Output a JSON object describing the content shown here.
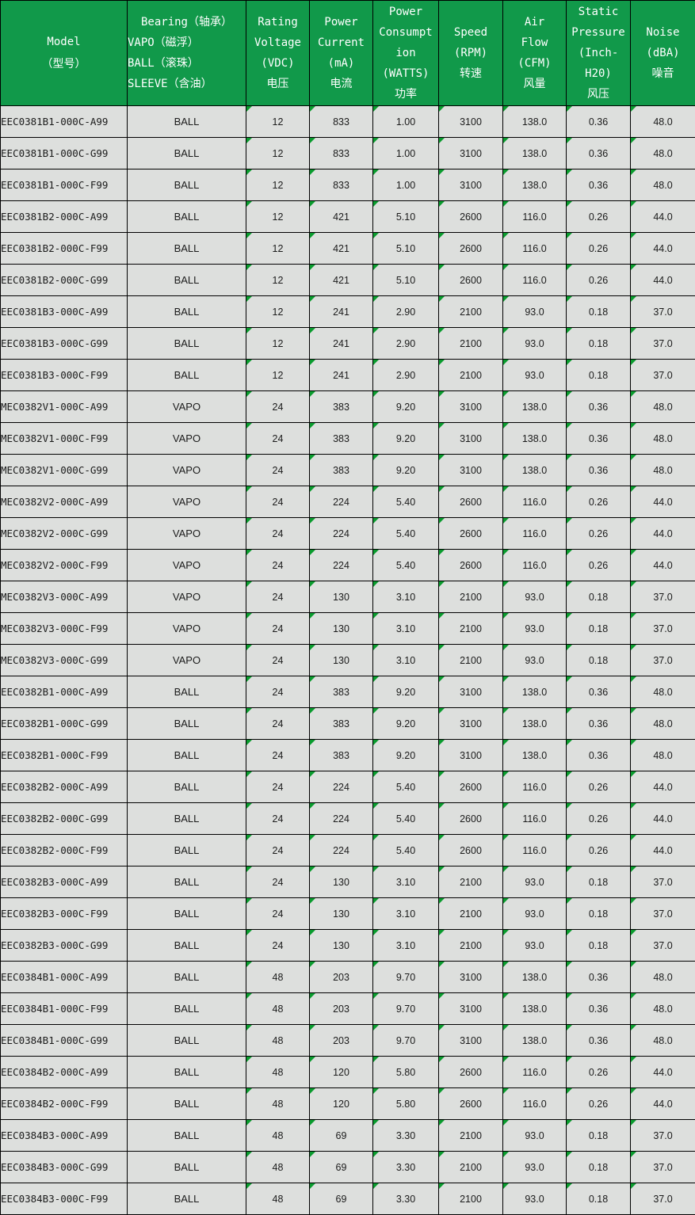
{
  "table": {
    "accent_header_color": "#11994a",
    "cell_background_color": "#dddfdd",
    "marker_color": "#0a9c2e",
    "columns": [
      {
        "key": "model",
        "lines": [
          "Model",
          "（型号）"
        ]
      },
      {
        "key": "bearing",
        "lines": [
          "Bearing（轴承）",
          "VAPO（磁浮）",
          "BALL（滚珠）",
          "SLEEVE（含油）"
        ]
      },
      {
        "key": "rating_voltage",
        "lines": [
          "Rating",
          "Voltage",
          "(VDC)",
          "电压"
        ]
      },
      {
        "key": "power_current",
        "lines": [
          "Power",
          "Current",
          "(mA)",
          "电流"
        ]
      },
      {
        "key": "power_consumption",
        "lines": [
          "Power",
          "Consumpt",
          "ion",
          "(WATTS)",
          "功率"
        ]
      },
      {
        "key": "speed",
        "lines": [
          "Speed",
          "(RPM)",
          "转速"
        ]
      },
      {
        "key": "air_flow",
        "lines": [
          "Air",
          "Flow",
          "(CFM)",
          "风量"
        ]
      },
      {
        "key": "static_pressure",
        "lines": [
          "Static",
          "Pressure",
          "(Inch-",
          "H20)",
          "风压"
        ]
      },
      {
        "key": "noise",
        "lines": [
          "Noise",
          "(dBA)",
          "噪音"
        ]
      }
    ],
    "rows": [
      {
        "model": "EEC0381B1-000C-A99",
        "bearing": "BALL",
        "rating_voltage": "12",
        "power_current": "833",
        "power_consumption": "1.00",
        "speed": "3100",
        "air_flow": "138.0",
        "static_pressure": "0.36",
        "noise": "48.0"
      },
      {
        "model": "EEC0381B1-000C-G99",
        "bearing": "BALL",
        "rating_voltage": "12",
        "power_current": "833",
        "power_consumption": "1.00",
        "speed": "3100",
        "air_flow": "138.0",
        "static_pressure": "0.36",
        "noise": "48.0"
      },
      {
        "model": "EEC0381B1-000C-F99",
        "bearing": "BALL",
        "rating_voltage": "12",
        "power_current": "833",
        "power_consumption": "1.00",
        "speed": "3100",
        "air_flow": "138.0",
        "static_pressure": "0.36",
        "noise": "48.0"
      },
      {
        "model": "EEC0381B2-000C-A99",
        "bearing": "BALL",
        "rating_voltage": "12",
        "power_current": "421",
        "power_consumption": "5.10",
        "speed": "2600",
        "air_flow": "116.0",
        "static_pressure": "0.26",
        "noise": "44.0"
      },
      {
        "model": "EEC0381B2-000C-F99",
        "bearing": "BALL",
        "rating_voltage": "12",
        "power_current": "421",
        "power_consumption": "5.10",
        "speed": "2600",
        "air_flow": "116.0",
        "static_pressure": "0.26",
        "noise": "44.0"
      },
      {
        "model": "EEC0381B2-000C-G99",
        "bearing": "BALL",
        "rating_voltage": "12",
        "power_current": "421",
        "power_consumption": "5.10",
        "speed": "2600",
        "air_flow": "116.0",
        "static_pressure": "0.26",
        "noise": "44.0"
      },
      {
        "model": "EEC0381B3-000C-A99",
        "bearing": "BALL",
        "rating_voltage": "12",
        "power_current": "241",
        "power_consumption": "2.90",
        "speed": "2100",
        "air_flow": "93.0",
        "static_pressure": "0.18",
        "noise": "37.0"
      },
      {
        "model": "EEC0381B3-000C-G99",
        "bearing": "BALL",
        "rating_voltage": "12",
        "power_current": "241",
        "power_consumption": "2.90",
        "speed": "2100",
        "air_flow": "93.0",
        "static_pressure": "0.18",
        "noise": "37.0"
      },
      {
        "model": "EEC0381B3-000C-F99",
        "bearing": "BALL",
        "rating_voltage": "12",
        "power_current": "241",
        "power_consumption": "2.90",
        "speed": "2100",
        "air_flow": "93.0",
        "static_pressure": "0.18",
        "noise": "37.0"
      },
      {
        "model": "MEC0382V1-000C-A99",
        "bearing": "VAPO",
        "rating_voltage": "24",
        "power_current": "383",
        "power_consumption": "9.20",
        "speed": "3100",
        "air_flow": "138.0",
        "static_pressure": "0.36",
        "noise": "48.0"
      },
      {
        "model": "MEC0382V1-000C-F99",
        "bearing": "VAPO",
        "rating_voltage": "24",
        "power_current": "383",
        "power_consumption": "9.20",
        "speed": "3100",
        "air_flow": "138.0",
        "static_pressure": "0.36",
        "noise": "48.0"
      },
      {
        "model": "MEC0382V1-000C-G99",
        "bearing": "VAPO",
        "rating_voltage": "24",
        "power_current": "383",
        "power_consumption": "9.20",
        "speed": "3100",
        "air_flow": "138.0",
        "static_pressure": "0.36",
        "noise": "48.0"
      },
      {
        "model": "MEC0382V2-000C-A99",
        "bearing": "VAPO",
        "rating_voltage": "24",
        "power_current": "224",
        "power_consumption": "5.40",
        "speed": "2600",
        "air_flow": "116.0",
        "static_pressure": "0.26",
        "noise": "44.0"
      },
      {
        "model": "MEC0382V2-000C-G99",
        "bearing": "VAPO",
        "rating_voltage": "24",
        "power_current": "224",
        "power_consumption": "5.40",
        "speed": "2600",
        "air_flow": "116.0",
        "static_pressure": "0.26",
        "noise": "44.0"
      },
      {
        "model": "MEC0382V2-000C-F99",
        "bearing": "VAPO",
        "rating_voltage": "24",
        "power_current": "224",
        "power_consumption": "5.40",
        "speed": "2600",
        "air_flow": "116.0",
        "static_pressure": "0.26",
        "noise": "44.0"
      },
      {
        "model": "MEC0382V3-000C-A99",
        "bearing": "VAPO",
        "rating_voltage": "24",
        "power_current": "130",
        "power_consumption": "3.10",
        "speed": "2100",
        "air_flow": "93.0",
        "static_pressure": "0.18",
        "noise": "37.0"
      },
      {
        "model": "MEC0382V3-000C-F99",
        "bearing": "VAPO",
        "rating_voltage": "24",
        "power_current": "130",
        "power_consumption": "3.10",
        "speed": "2100",
        "air_flow": "93.0",
        "static_pressure": "0.18",
        "noise": "37.0"
      },
      {
        "model": "MEC0382V3-000C-G99",
        "bearing": "VAPO",
        "rating_voltage": "24",
        "power_current": "130",
        "power_consumption": "3.10",
        "speed": "2100",
        "air_flow": "93.0",
        "static_pressure": "0.18",
        "noise": "37.0"
      },
      {
        "model": "EEC0382B1-000C-A99",
        "bearing": "BALL",
        "rating_voltage": "24",
        "power_current": "383",
        "power_consumption": "9.20",
        "speed": "3100",
        "air_flow": "138.0",
        "static_pressure": "0.36",
        "noise": "48.0"
      },
      {
        "model": "EEC0382B1-000C-G99",
        "bearing": "BALL",
        "rating_voltage": "24",
        "power_current": "383",
        "power_consumption": "9.20",
        "speed": "3100",
        "air_flow": "138.0",
        "static_pressure": "0.36",
        "noise": "48.0"
      },
      {
        "model": "EEC0382B1-000C-F99",
        "bearing": "BALL",
        "rating_voltage": "24",
        "power_current": "383",
        "power_consumption": "9.20",
        "speed": "3100",
        "air_flow": "138.0",
        "static_pressure": "0.36",
        "noise": "48.0"
      },
      {
        "model": "EEC0382B2-000C-A99",
        "bearing": "BALL",
        "rating_voltage": "24",
        "power_current": "224",
        "power_consumption": "5.40",
        "speed": "2600",
        "air_flow": "116.0",
        "static_pressure": "0.26",
        "noise": "44.0"
      },
      {
        "model": "EEC0382B2-000C-G99",
        "bearing": "BALL",
        "rating_voltage": "24",
        "power_current": "224",
        "power_consumption": "5.40",
        "speed": "2600",
        "air_flow": "116.0",
        "static_pressure": "0.26",
        "noise": "44.0"
      },
      {
        "model": "EEC0382B2-000C-F99",
        "bearing": "BALL",
        "rating_voltage": "24",
        "power_current": "224",
        "power_consumption": "5.40",
        "speed": "2600",
        "air_flow": "116.0",
        "static_pressure": "0.26",
        "noise": "44.0"
      },
      {
        "model": "EEC0382B3-000C-A99",
        "bearing": "BALL",
        "rating_voltage": "24",
        "power_current": "130",
        "power_consumption": "3.10",
        "speed": "2100",
        "air_flow": "93.0",
        "static_pressure": "0.18",
        "noise": "37.0"
      },
      {
        "model": "EEC0382B3-000C-F99",
        "bearing": "BALL",
        "rating_voltage": "24",
        "power_current": "130",
        "power_consumption": "3.10",
        "speed": "2100",
        "air_flow": "93.0",
        "static_pressure": "0.18",
        "noise": "37.0"
      },
      {
        "model": "EEC0382B3-000C-G99",
        "bearing": "BALL",
        "rating_voltage": "24",
        "power_current": "130",
        "power_consumption": "3.10",
        "speed": "2100",
        "air_flow": "93.0",
        "static_pressure": "0.18",
        "noise": "37.0"
      },
      {
        "model": "EEC0384B1-000C-A99",
        "bearing": "BALL",
        "rating_voltage": "48",
        "power_current": "203",
        "power_consumption": "9.70",
        "speed": "3100",
        "air_flow": "138.0",
        "static_pressure": "0.36",
        "noise": "48.0"
      },
      {
        "model": "EEC0384B1-000C-F99",
        "bearing": "BALL",
        "rating_voltage": "48",
        "power_current": "203",
        "power_consumption": "9.70",
        "speed": "3100",
        "air_flow": "138.0",
        "static_pressure": "0.36",
        "noise": "48.0"
      },
      {
        "model": "EEC0384B1-000C-G99",
        "bearing": "BALL",
        "rating_voltage": "48",
        "power_current": "203",
        "power_consumption": "9.70",
        "speed": "3100",
        "air_flow": "138.0",
        "static_pressure": "0.36",
        "noise": "48.0"
      },
      {
        "model": "EEC0384B2-000C-A99",
        "bearing": "BALL",
        "rating_voltage": "48",
        "power_current": "120",
        "power_consumption": "5.80",
        "speed": "2600",
        "air_flow": "116.0",
        "static_pressure": "0.26",
        "noise": "44.0"
      },
      {
        "model": "EEC0384B2-000C-F99",
        "bearing": "BALL",
        "rating_voltage": "48",
        "power_current": "120",
        "power_consumption": "5.80",
        "speed": "2600",
        "air_flow": "116.0",
        "static_pressure": "0.26",
        "noise": "44.0"
      },
      {
        "model": "EEC0384B3-000C-A99",
        "bearing": "BALL",
        "rating_voltage": "48",
        "power_current": "69",
        "power_consumption": "3.30",
        "speed": "2100",
        "air_flow": "93.0",
        "static_pressure": "0.18",
        "noise": "37.0"
      },
      {
        "model": "EEC0384B3-000C-G99",
        "bearing": "BALL",
        "rating_voltage": "48",
        "power_current": "69",
        "power_consumption": "3.30",
        "speed": "2100",
        "air_flow": "93.0",
        "static_pressure": "0.18",
        "noise": "37.0"
      },
      {
        "model": "EEC0384B3-000C-F99",
        "bearing": "BALL",
        "rating_voltage": "48",
        "power_current": "69",
        "power_consumption": "3.30",
        "speed": "2100",
        "air_flow": "93.0",
        "static_pressure": "0.18",
        "noise": "37.0"
      }
    ]
  }
}
